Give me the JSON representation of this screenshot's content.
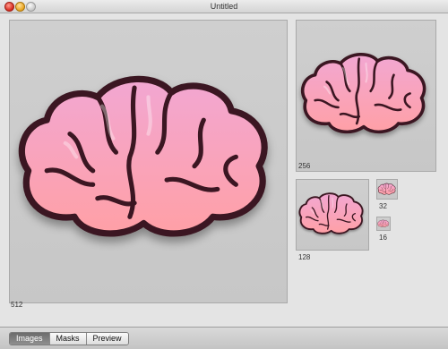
{
  "window": {
    "title": "Untitled"
  },
  "icon_sizes": [
    {
      "label": "512"
    },
    {
      "label": "256"
    },
    {
      "label": "128"
    },
    {
      "label": "32"
    },
    {
      "label": "16"
    }
  ],
  "tabs": {
    "images": "Images",
    "masks": "Masks",
    "preview": "Preview",
    "selected": "Images"
  },
  "colors": {
    "brain_top": "#f2a7d2",
    "brain_bottom": "#ff9fa6",
    "outline": "#3b1720"
  }
}
